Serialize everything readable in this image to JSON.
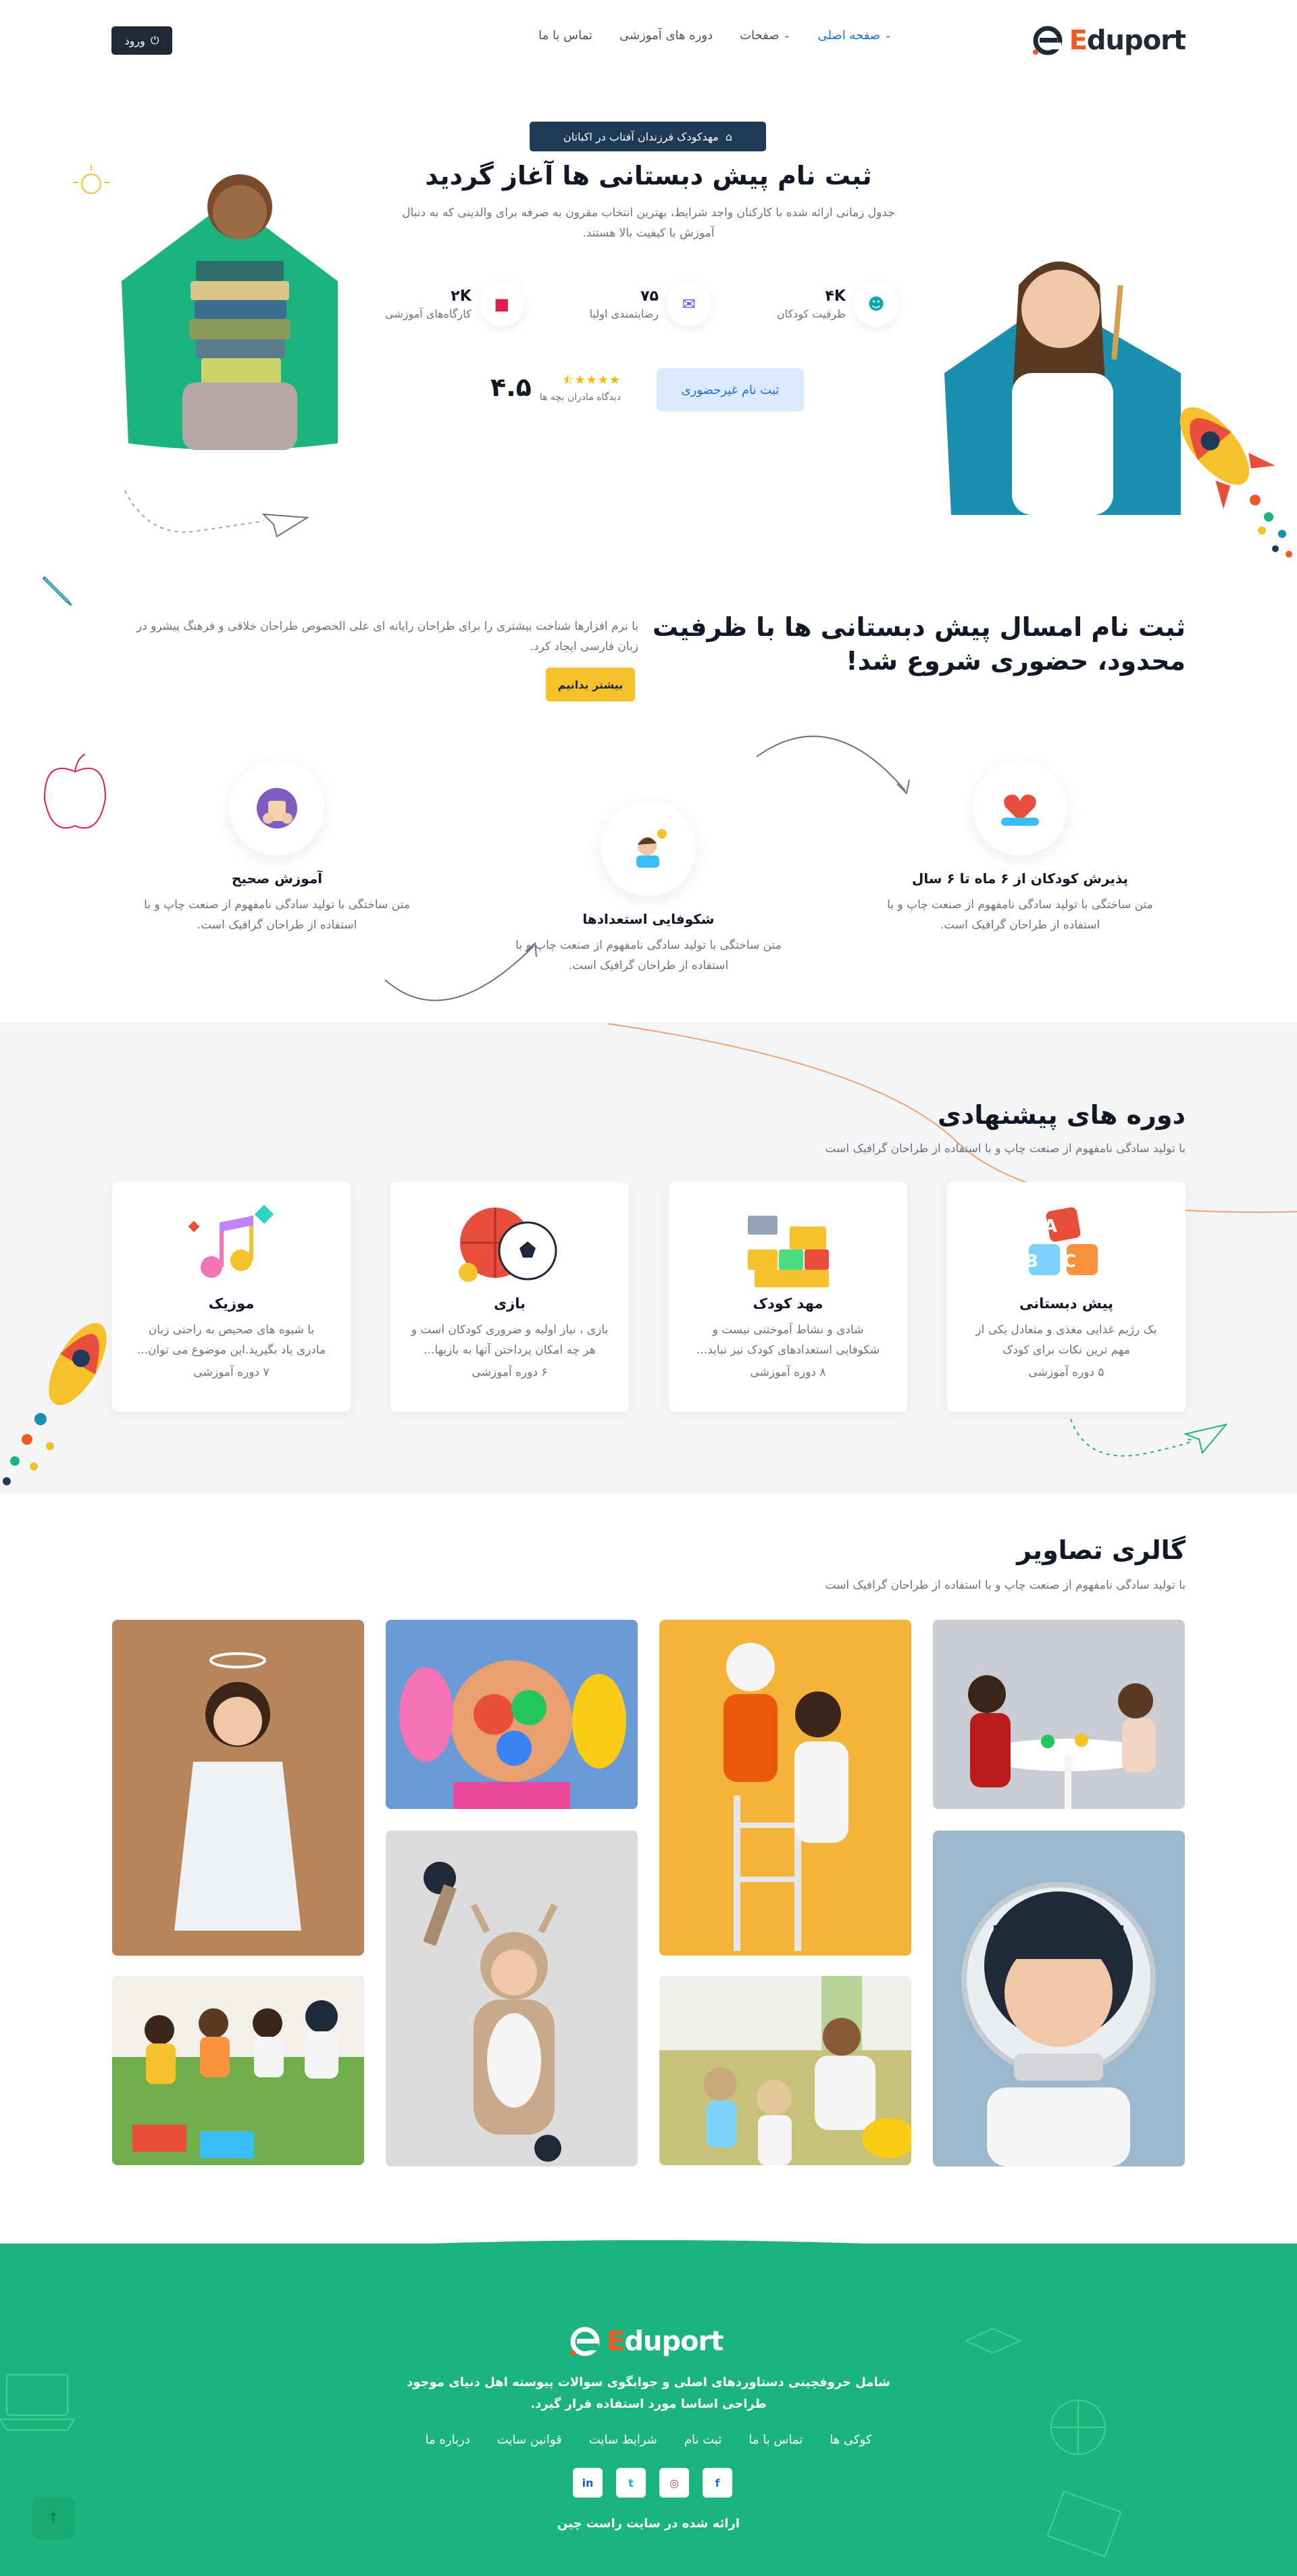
{
  "header": {
    "logo_text_prefix": "E",
    "logo_text_rest": "duport",
    "nav": [
      {
        "label": "صفحه اصلی",
        "active": true,
        "has_dropdown": true
      },
      {
        "label": "صفحات",
        "active": false,
        "has_dropdown": true
      },
      {
        "label": "دوره های آموزشی",
        "active": false,
        "has_dropdown": false
      },
      {
        "label": "تماس با ما",
        "active": false,
        "has_dropdown": false
      }
    ],
    "login_label": "ورود"
  },
  "hero": {
    "badge": "مهدکودک فرزندان آفتاب در اکباتان",
    "title": "ثبت نام پیش دبستانی ها آغاز گردید",
    "description": "جدول زمانی ارائه شده با کارکنان واجد شرایط، بهترین انتخاب مقرون به صرفه برای والدینی که به دنبال آموزش با کیفیت بالا هستند.",
    "stats": [
      {
        "value": "۴K",
        "label": "ظرفیت کودکان",
        "icon": "child-icon",
        "color": "#0ea5b0"
      },
      {
        "value": "۷۵",
        "label": "رضایتمندی اولیا",
        "icon": "chat-icon",
        "color": "#7c3aed"
      },
      {
        "value": "۲K",
        "label": "کارگاه‌های آموزشی",
        "icon": "book-icon",
        "color": "#e11d48"
      }
    ],
    "register_button": "ثبت نام غیرحضوری",
    "rating_value": "۴.۵",
    "rating_stars": 4.5,
    "rating_label": "دیدگاه مادران بچه ها"
  },
  "section2": {
    "title": "ثبت نام امسال پیش دبستانی ها با ظرفیت محدود، حضوری شروع شد!",
    "description": "با نرم افزارها شناخت بیشتری را برای طراحان رایانه ای علی الخصوص طراحان خلاقی و فرهنگ پیشرو در زبان فارسی ایجاد کرد.",
    "more_button": "بیشتر بدانیم",
    "features": [
      {
        "title": "پذیرش کودکان از ۶ ماه تا ۶ سال",
        "description": "متن ساختگی با تولید سادگی نامفهوم از صنعت چاپ و با استفاده از طراحان گرافیک است.",
        "icon": "heart-hands-icon"
      },
      {
        "title": "شکوفایی استعدادها",
        "description": "متن ساختگی با تولید سادگی نامفهوم از صنعت چاپ و با استفاده از طراحان گرافیک است.",
        "icon": "idea-boy-icon"
      },
      {
        "title": "آموزش صحیح",
        "description": "متن ساختگی با تولید سادگی نامفهوم از صنعت چاپ و با استفاده از طراحان گرافیک است.",
        "icon": "teacher-icon"
      }
    ]
  },
  "courses": {
    "title": "دوره های پیشنهادی",
    "subtitle": "با تولید سادگی نامفهوم از صنعت چاپ و با استفاده از طراحان گرافیک است",
    "items": [
      {
        "title": "پیش دبستانی",
        "description": "یک رژیم غذایی مغذی و متعادل یکی از مهم ترین نکات برای کودک",
        "count": "۵ دوره آموزشی",
        "icon": "abc-blocks-icon"
      },
      {
        "title": "مهد کودک",
        "description": "شادی و نشاط آموختنی نیست و شکوفایی استعدادهای کودک نیز نباید...",
        "count": "۸ دوره آموزشی",
        "icon": "lego-bricks-icon"
      },
      {
        "title": "بازی",
        "description": "بازی ، نیاز اولیه و ضروری کودکان است و هر چه امکان پرداختن آنها به بازیها...",
        "count": "۶ دوره آموزشی",
        "icon": "balls-icon"
      },
      {
        "title": "موزیک",
        "description": "با شیوه های صحیص به راحتی زبان مادری یاد بگیرید.این موضوع می توان...",
        "count": "۷ دوره آموزشی",
        "icon": "music-notes-icon"
      }
    ]
  },
  "gallery": {
    "title": "گالری تصاویر",
    "subtitle": "با تولید سادگی نامفهوم از صنعت چاپ و با استفاده از طراحان گرافیک است",
    "photos": [
      {
        "name": "girl-angel-photo",
        "color": "#b8845a"
      },
      {
        "name": "painted-face-photo",
        "color": "#6a9bd8"
      },
      {
        "name": "astronaut-kids-photo",
        "color": "#f4b43a"
      },
      {
        "name": "kids-table-photo",
        "color": "#c9ccd2"
      },
      {
        "name": "kids-yoga-photo",
        "color": "#6fae4a"
      },
      {
        "name": "deer-costume-photo",
        "color": "#dcdcdc"
      },
      {
        "name": "reading-teacher-photo",
        "color": "#c7c27a"
      },
      {
        "name": "helmet-boy-photo",
        "color": "#9bb8cc"
      }
    ]
  },
  "footer": {
    "description": "شامل حروفچینی دستاوردهای اصلی و جوابگوی سوالات پیوسته اهل دنیای موجود طراحی اساسا مورد استفاده قرار گیرد.",
    "links": [
      "درباره ما",
      "قوانین سایت",
      "شرایط سایت",
      "ثبت نام",
      "تماس با ما",
      "کوکی ها"
    ],
    "socials": [
      {
        "label": "f",
        "icon": "facebook-icon",
        "color": "#1877f2"
      },
      {
        "label": "◎",
        "icon": "instagram-icon",
        "color": "#e1306c"
      },
      {
        "label": "t",
        "icon": "twitter-icon",
        "color": "#1da1f2"
      },
      {
        "label": "in",
        "icon": "linkedin-icon",
        "color": "#0a66c2"
      }
    ],
    "copyright": "ارائه شده در سایت راست چین"
  },
  "colors": {
    "brand_orange": "#f15a24",
    "primary_blue": "#1d6fd8",
    "footer_green": "#1bb37e",
    "accent_yellow": "#f6c12a",
    "dark": "#1e3a56"
  }
}
